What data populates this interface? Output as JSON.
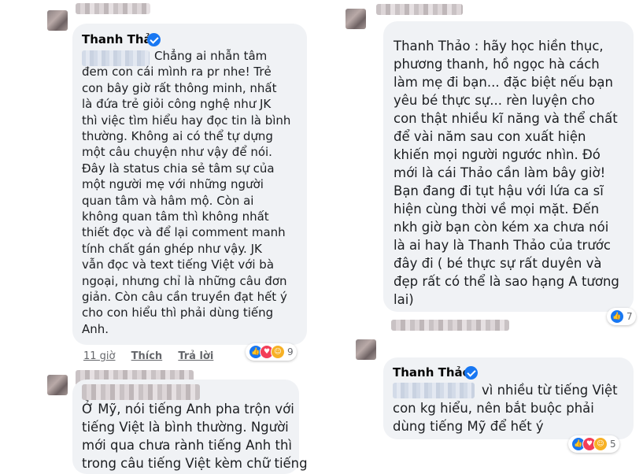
{
  "left_comment": {
    "author": "Thanh Thảo",
    "text_lines": [
      "Chẳng ai nhẫn tâm",
      "đem con cái mình ra pr nhe! Trẻ",
      "con bây giờ rất thông minh, nhất",
      "là đứa trẻ giỏi công nghệ như JK",
      "thì việc tìm hiểu hay đọc tin là bình",
      "thường. Không ai có thể tự dựng",
      "một câu chuyện như vậy để nói.",
      "Đây là status chia sẻ tâm sự của",
      "một người mẹ với những người",
      "quan tâm và hâm mộ. Còn ai",
      "không quan tâm thì không nhất",
      "thiết đọc và để lại comment manh",
      "tính chất gán ghép như vậy. JK",
      "vẫn đọc và text tiếng Việt với bà",
      "ngoại, nhưng chỉ là những câu đơn",
      "giản. Còn câu cần truyền đạt hết ý",
      "cho con hiểu thì phải dùng tiếng",
      "Anh."
    ],
    "time": "11 giờ",
    "like_label": "Thích",
    "reply_label": "Trả lời",
    "reaction_count": "9"
  },
  "left_bottom_comment": {
    "text_lines": [
      "Ở Mỹ, nói tiếng Anh pha trộn với",
      "tiếng Việt là bình thường. Người",
      "mới qua chưa rành tiếng Anh thì",
      "trong câu tiếng Việt kèm chữ tiếng"
    ]
  },
  "right_top_comment": {
    "text_lines": [
      "Thanh Thảo :  hãy học hiền thục,",
      "phương thanh, hồ ngọc hà cách",
      "làm mẹ đi bạn... đặc biệt nếu bạn",
      "yêu bé thực sự... rèn luyện cho",
      "con thật nhiều kĩ năng và thể chất",
      "để vài năm sau con xuất hiện",
      "khiến mọi người ngước nhìn. Đó",
      "mới là cái Thảo cần làm bây giờ!",
      "Bạn đang đi tụt hậu với lứa ca sĩ",
      "hiện cùng thời về mọi mặt. Đến",
      "nkh giờ bạn còn kém xa chưa nói",
      "là ai hay là Thanh Thảo của trước",
      "đây đi ( bé thực sự rất duyên và",
      "đẹp rất có thể là sao hạng A tương",
      "lai)"
    ],
    "reaction_count": "7"
  },
  "right_bottom_comment": {
    "author": "Thanh Thảo",
    "text_lines": [
      "vì nhiều từ tiếng Việt",
      "con kg hiểu, nên bắt buộc phải",
      "dùng tiếng Mỹ để hết ý"
    ],
    "reaction_count": "5"
  },
  "colors": {
    "bubble": "#f0f2f5",
    "text": "#1c1e21",
    "meta": "#65676b",
    "verified": "#1877f2",
    "like": "#1877f2",
    "love": "#f33e58",
    "haha": "#f7b125"
  },
  "icons": [
    "verified-badge-icon",
    "like-reaction-icon",
    "love-reaction-icon",
    "haha-reaction-icon"
  ]
}
